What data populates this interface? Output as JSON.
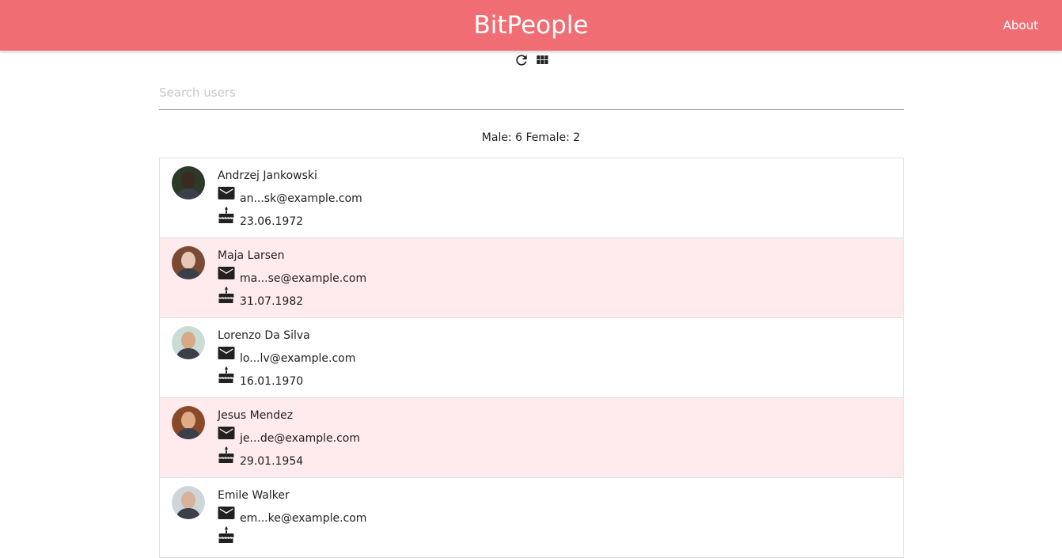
{
  "navbar": {
    "brand": "BitPeople",
    "about_label": "About",
    "color": "#f06e73"
  },
  "toolbar": {
    "refresh_icon": "refresh-icon",
    "grid_icon": "grid-view-icon"
  },
  "search": {
    "placeholder": "Search users",
    "value": ""
  },
  "stats": {
    "text": "Male: 6 Female: 2"
  },
  "users": [
    {
      "name": "Andrzej Jankowski",
      "email": "an...sk@example.com",
      "dob": "23.06.1972",
      "highlight": false,
      "avatar_skin": "#3b2a22",
      "avatar_bg": "#2c3a2a"
    },
    {
      "name": "Maja Larsen",
      "email": "ma...se@example.com",
      "dob": "31.07.1982",
      "highlight": true,
      "avatar_skin": "#e8c7b4",
      "avatar_bg": "#7a4a35"
    },
    {
      "name": "Lorenzo Da Silva",
      "email": "lo...lv@example.com",
      "dob": "16.01.1970",
      "highlight": false,
      "avatar_skin": "#d9a987",
      "avatar_bg": "#c9ddd6"
    },
    {
      "name": "Jesus Mendez",
      "email": "je...de@example.com",
      "dob": "29.01.1954",
      "highlight": true,
      "avatar_skin": "#e0aa86",
      "avatar_bg": "#8a4a2a"
    },
    {
      "name": "Emile Walker",
      "email": "em...ke@example.com",
      "dob": "",
      "highlight": false,
      "avatar_skin": "#d7b19a",
      "avatar_bg": "#cfd6da"
    }
  ],
  "colors": {
    "highlight_row": "#ffebee",
    "text": "#212121"
  }
}
